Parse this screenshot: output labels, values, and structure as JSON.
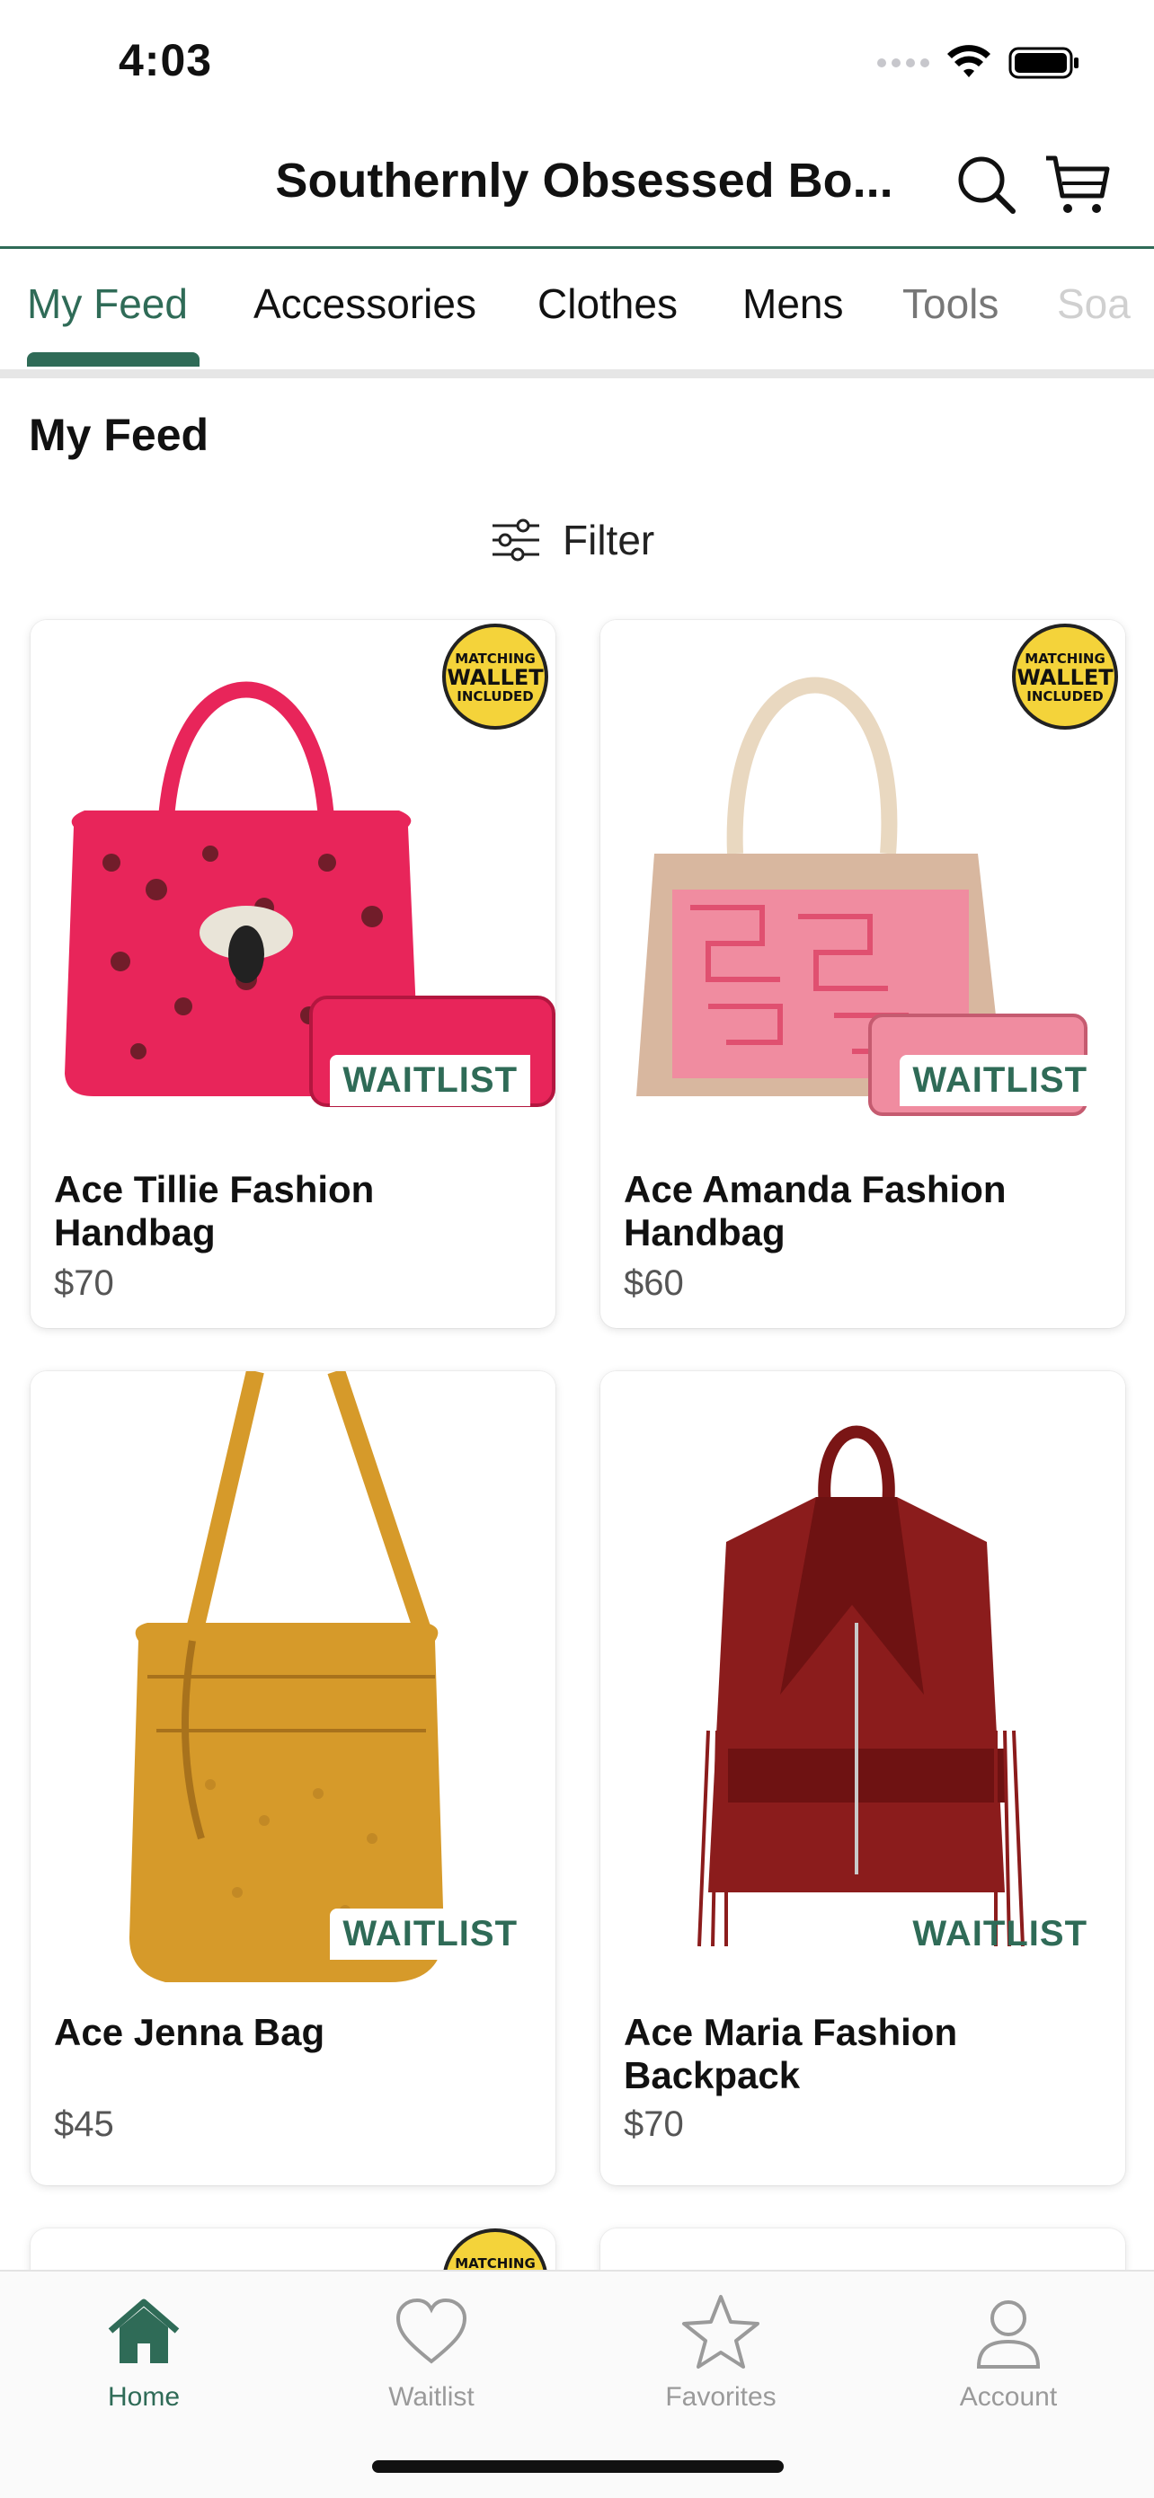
{
  "status_bar": {
    "time": "4:03"
  },
  "header": {
    "title": "Southernly Obsessed Bo...",
    "search_icon": "search-icon",
    "cart_icon": "cart-icon"
  },
  "tabs": [
    {
      "label": "My Feed",
      "active": true
    },
    {
      "label": "Accessories"
    },
    {
      "label": "Clothes"
    },
    {
      "label": "Mens"
    },
    {
      "label": "Tools"
    },
    {
      "label": "Soa"
    }
  ],
  "feed": {
    "title": "My Feed",
    "filter_label": "Filter"
  },
  "badge": {
    "line1": "MATCHING",
    "line2": "WALLET",
    "line3": "INCLUDED"
  },
  "products": [
    {
      "title": "Ace Tillie Fashion Handbag",
      "price": "$70",
      "status": "WAITLIST",
      "badge": true,
      "color": "#e8255a"
    },
    {
      "title": "Ace Amanda Fashion Handbag",
      "price": "$60",
      "status": "WAITLIST",
      "badge": true,
      "color": "#d8b79f"
    },
    {
      "title": "Ace Jenna Bag",
      "price": "$45",
      "status": "WAITLIST",
      "badge": false,
      "color": "#d69a2a"
    },
    {
      "title": "Ace Maria Fashion Backpack",
      "price": "$70",
      "status": "WAITLIST",
      "badge": false,
      "color": "#8b1c1c"
    }
  ],
  "bottom_nav": [
    {
      "label": "Home",
      "icon": "home-icon",
      "active": true
    },
    {
      "label": "Waitlist",
      "icon": "heart-icon"
    },
    {
      "label": "Favorites",
      "icon": "star-icon"
    },
    {
      "label": "Account",
      "icon": "person-icon"
    }
  ],
  "colors": {
    "accent": "#2f6b57",
    "badge": "#f4d33a"
  }
}
